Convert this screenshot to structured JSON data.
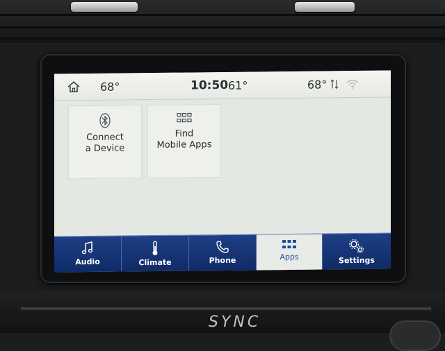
{
  "status_bar": {
    "left_temp": "68°",
    "clock": "10:50",
    "outside_temp": "61°",
    "right_temp": "68°"
  },
  "tiles": [
    {
      "line1": "Connect",
      "line2": "a Device",
      "icon": "bluetooth-icon"
    },
    {
      "line1": "Find",
      "line2": "Mobile Apps",
      "icon": "grid-icon"
    }
  ],
  "nav": {
    "audio": "Audio",
    "climate": "Climate",
    "phone": "Phone",
    "apps": "Apps",
    "settings": "Settings",
    "active": "apps"
  },
  "brand": {
    "logo": "SYNC"
  },
  "colors": {
    "nav_bg": "#1e3f86",
    "active_text": "#1f4ba0",
    "screen_bg": "#e4e8e3"
  }
}
